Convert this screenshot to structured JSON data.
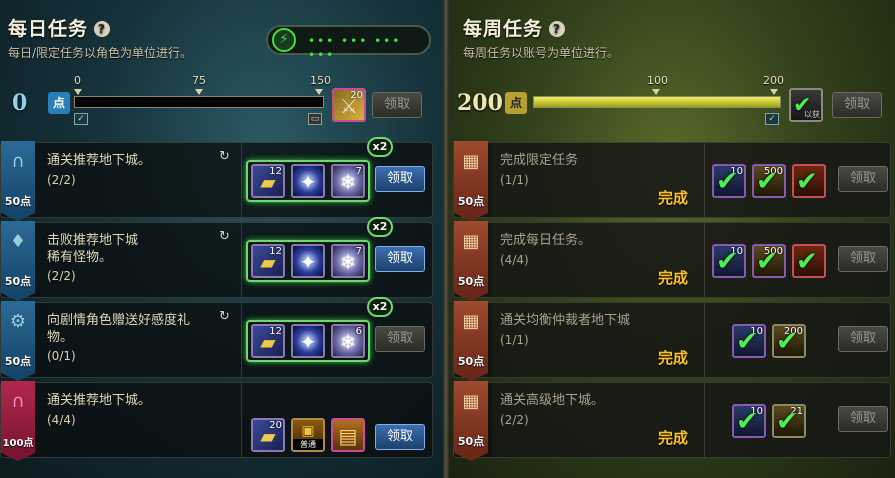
{
  "daily": {
    "title": "每日任务",
    "help": "?",
    "subtitle": "每日/限定任务以角色为单位进行。",
    "points": "0",
    "point_badge": "点",
    "progress_fraction": 0.0,
    "tick_labels": [
      "0",
      "75",
      "150"
    ],
    "claim_label": "领取",
    "reward_item_count": "20",
    "led_icon": "battery-icon",
    "led_dots": "••• ••• ••• •••",
    "tasks": [
      {
        "points": "50点",
        "icon": "gate-icon",
        "name": "通关推荐地下城。",
        "progress": "(2/2)",
        "refresh": "↻",
        "multiplier": "x2",
        "rewards": [
          {
            "count": "12",
            "icon": "ticket-icon"
          },
          {
            "count": "",
            "icon": "orb-icon"
          },
          {
            "count": "7",
            "icon": "crystal-icon"
          }
        ],
        "claim_label": "领取",
        "claimable": true
      },
      {
        "points": "50点",
        "icon": "crystal-shard-icon",
        "name": "击败推荐地下城稀有怪物。",
        "name_line1": "击败推荐地下城",
        "name_line2": "稀有怪物。",
        "progress": "(2/2)",
        "refresh": "↻",
        "multiplier": "x2",
        "rewards": [
          {
            "count": "12",
            "icon": "ticket-icon"
          },
          {
            "count": "",
            "icon": "orb-icon"
          },
          {
            "count": "7",
            "icon": "crystal-icon"
          }
        ],
        "claim_label": "领取",
        "claimable": true
      },
      {
        "points": "50点",
        "icon": "gear-icon",
        "name_line1": "向剧情角色赠送好感度礼",
        "name_line2": "物。",
        "progress": "(0/1)",
        "refresh": "↻",
        "multiplier": "x2",
        "rewards": [
          {
            "count": "12",
            "icon": "ticket-icon"
          },
          {
            "count": "",
            "icon": "orb-icon"
          },
          {
            "count": "6",
            "icon": "crystal-icon"
          }
        ],
        "claim_label": "领取",
        "claimable": false
      },
      {
        "points": "100点",
        "icon": "gate-icon",
        "name": "通关推荐地下城。",
        "progress": "(4/4)",
        "rewards": [
          {
            "count": "20",
            "icon": "ticket-icon"
          },
          {
            "count": "",
            "icon": "chest-icon",
            "label": "普通"
          },
          {
            "count": "",
            "icon": "treasure-box-icon"
          }
        ],
        "claim_label": "领取",
        "claimable": true
      }
    ]
  },
  "weekly": {
    "title": "每周任务",
    "help": "?",
    "subtitle": "每周任务以账号为单位进行。",
    "points": "200",
    "point_badge": "点",
    "progress_fraction": 1.0,
    "tick_labels": [
      "100",
      "200"
    ],
    "claim_label": "领取",
    "reward_label": "以获",
    "tasks": [
      {
        "points": "50点",
        "icon": "calendar-icon",
        "name": "完成限定任务",
        "progress": "(1/1)",
        "status": "完成",
        "rewards": [
          {
            "count": "10",
            "icon": "check-icon"
          },
          {
            "count": "500",
            "icon": "check-icon"
          },
          {
            "count": "",
            "icon": "check-icon"
          }
        ],
        "claim_label": "领取"
      },
      {
        "points": "50点",
        "icon": "calendar-icon",
        "name": "完成每日任务。",
        "progress": "(4/4)",
        "status": "完成",
        "rewards": [
          {
            "count": "10",
            "icon": "check-icon"
          },
          {
            "count": "500",
            "icon": "check-icon"
          },
          {
            "count": "",
            "icon": "check-icon"
          }
        ],
        "claim_label": "领取"
      },
      {
        "points": "50点",
        "icon": "calendar-icon",
        "name": "通关均衡仲裁者地下城",
        "progress": "(1/1)",
        "status": "完成",
        "rewards": [
          {
            "count": "10",
            "icon": "check-icon"
          },
          {
            "count": "200",
            "icon": "check-icon"
          }
        ],
        "claim_label": "领取"
      },
      {
        "points": "50点",
        "icon": "calendar-icon",
        "name": "通关高级地下城。",
        "progress": "(2/2)",
        "status": "完成",
        "rewards": [
          {
            "count": "10",
            "icon": "check-icon"
          },
          {
            "count": "21",
            "icon": "check-icon"
          }
        ],
        "claim_label": "领取"
      }
    ]
  }
}
